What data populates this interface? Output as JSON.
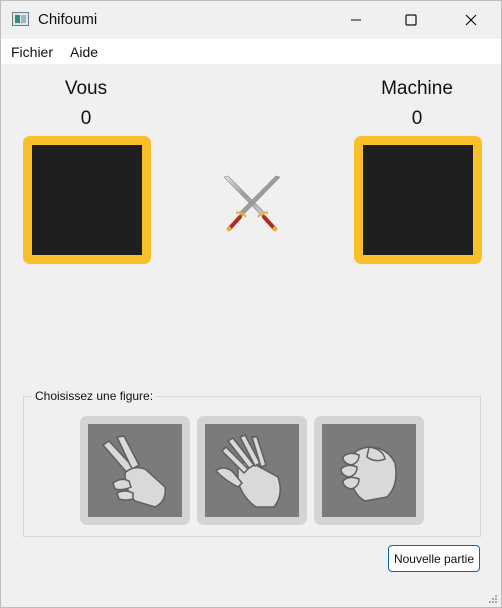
{
  "window": {
    "title": "Chifoumi"
  },
  "menu": {
    "items": [
      "Fichier",
      "Aide"
    ]
  },
  "player": {
    "label": "Vous",
    "score": "0"
  },
  "machine": {
    "label": "Machine",
    "score": "0"
  },
  "choices": {
    "group_title": "Choisissez une figure:",
    "figures": [
      "ciseaux",
      "feuille",
      "pierre"
    ]
  },
  "actions": {
    "new_game": "Nouvelle partie"
  },
  "colors": {
    "box_frame": "#fbbf2a",
    "box_fill": "#1f1f1f",
    "figure_tile": "#d4d4d4",
    "figure_fill": "#7b7b7b",
    "focus": "#0067c0"
  },
  "icons": {
    "center": "crossed-swords-icon"
  }
}
